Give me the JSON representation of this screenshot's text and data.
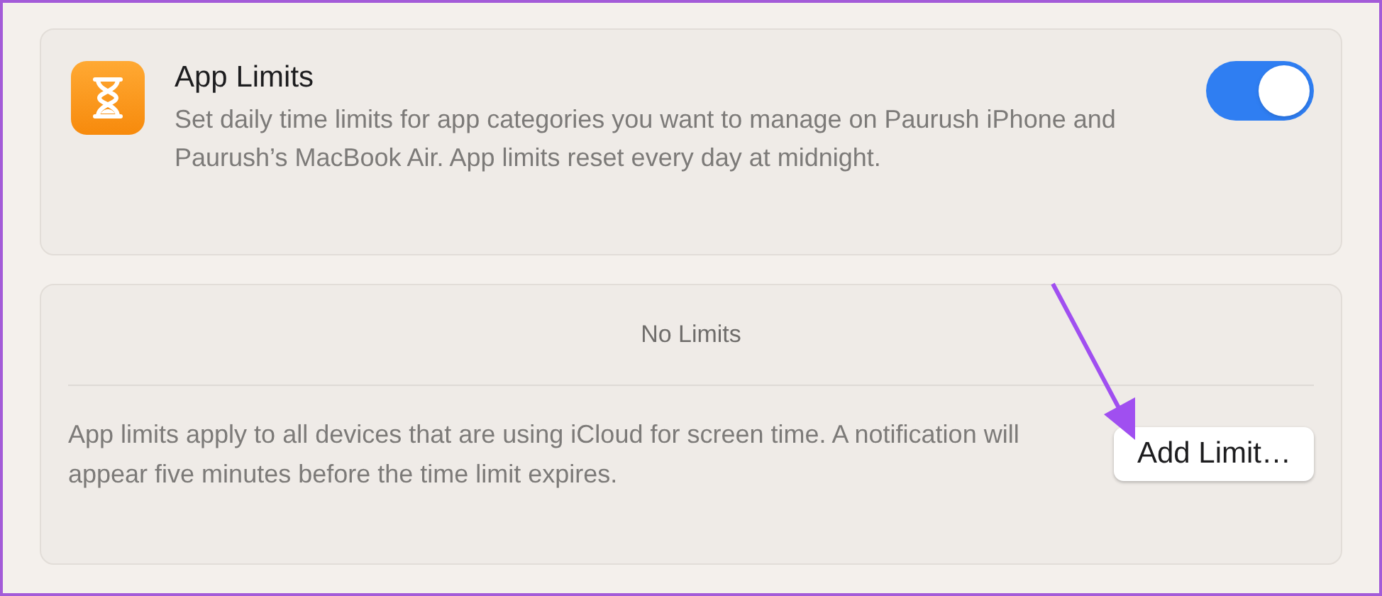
{
  "app_limits": {
    "title": "App Limits",
    "description": "Set daily time limits for app categories you want to manage on Paurush iPhone  and Paurush’s MacBook Air. App limits reset every day at midnight.",
    "on": true
  },
  "limits": {
    "empty_text": "No Limits",
    "note": "App limits apply to all devices that are using iCloud for screen time. A notification will appear five minutes before the time limit expires.",
    "button": "Add Limit…"
  }
}
